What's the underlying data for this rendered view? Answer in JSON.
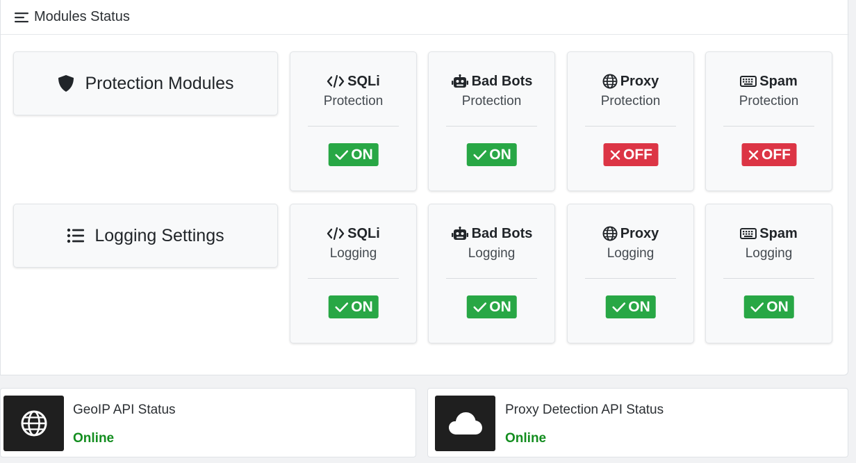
{
  "header": {
    "title": "Modules Status"
  },
  "sections": {
    "protection": {
      "title": "Protection Modules"
    },
    "logging": {
      "title": "Logging Settings"
    }
  },
  "protection_modules": [
    {
      "name": "SQLi",
      "sub": "Protection",
      "icon": "code-icon",
      "status": "ON"
    },
    {
      "name": "Bad Bots",
      "sub": "Protection",
      "icon": "robot-icon",
      "status": "ON"
    },
    {
      "name": "Proxy",
      "sub": "Protection",
      "icon": "globe-icon",
      "status": "OFF"
    },
    {
      "name": "Spam",
      "sub": "Protection",
      "icon": "keyboard-icon",
      "status": "OFF"
    }
  ],
  "logging_modules": [
    {
      "name": "SQLi",
      "sub": "Logging",
      "icon": "code-icon",
      "status": "ON"
    },
    {
      "name": "Bad Bots",
      "sub": "Logging",
      "icon": "robot-icon",
      "status": "ON"
    },
    {
      "name": "Proxy",
      "sub": "Logging",
      "icon": "globe-icon",
      "status": "ON"
    },
    {
      "name": "Spam",
      "sub": "Logging",
      "icon": "keyboard-icon",
      "status": "ON"
    }
  ],
  "apis": [
    {
      "title": "GeoIP API Status",
      "status": "Online",
      "icon": "globe-icon"
    },
    {
      "title": "Proxy Detection API Status",
      "status": "Online",
      "icon": "cloud-icon"
    }
  ],
  "colors": {
    "on": "#28a745",
    "off": "#dc3545",
    "online": "#138d1f",
    "icon_box": "#1f1f1f"
  }
}
